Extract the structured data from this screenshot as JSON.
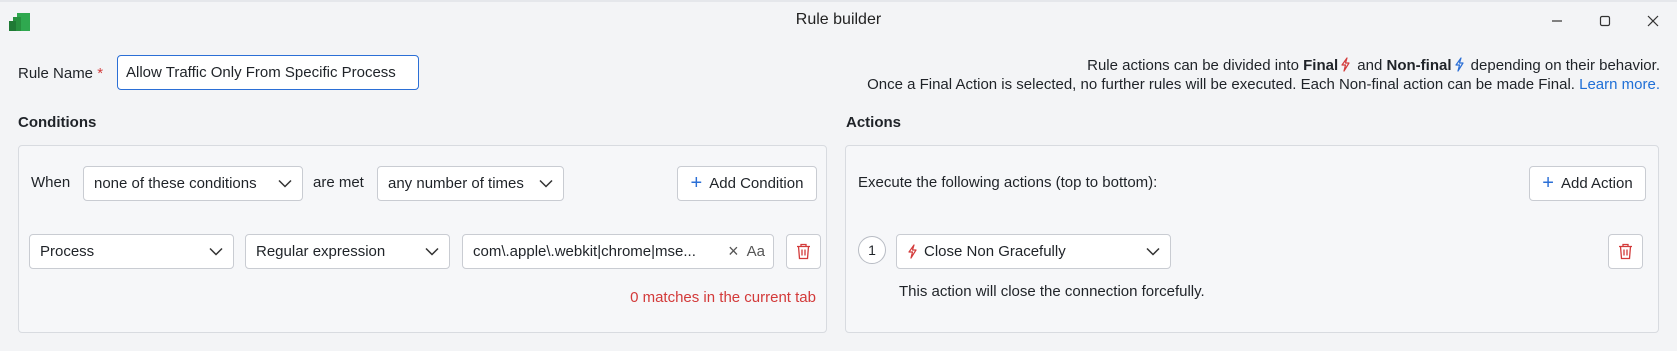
{
  "window": {
    "title": "Rule builder"
  },
  "rule_name": {
    "label": "Rule Name",
    "required_mark": "*",
    "value": "Allow Traffic Only From Specific Process"
  },
  "info": {
    "line1_prefix": "Rule actions can be divided into",
    "final": "Final",
    "and": "and",
    "non_final": "Non-final",
    "line1_suffix": "depending on their behavior.",
    "line2": "Once a Final Action is selected, no further rules will be executed. Each Non-final action can be made Final.",
    "learn_more": "Learn more."
  },
  "conditions": {
    "title": "Conditions",
    "when_label": "When",
    "match_mode": "none of these conditions",
    "are_met_label": "are met",
    "times_mode": "any number of times",
    "add_button": "Add Condition",
    "row": {
      "field": "Process",
      "operator": "Regular expression",
      "value": "com\\.apple\\.webkit|chrome|mse...",
      "case_toggle": "Aa"
    },
    "matches_text": "0 matches in the current tab"
  },
  "actions": {
    "title": "Actions",
    "description": "Execute the following actions (top to bottom):",
    "add_button": "Add Action",
    "items": [
      {
        "step": "1",
        "action": "Close Non Gracefully",
        "help": "This action will close the connection forcefully."
      }
    ]
  },
  "colors": {
    "accent": "#2b6fd6",
    "danger": "#d33a3a",
    "app_icon": "#2fa84f"
  }
}
